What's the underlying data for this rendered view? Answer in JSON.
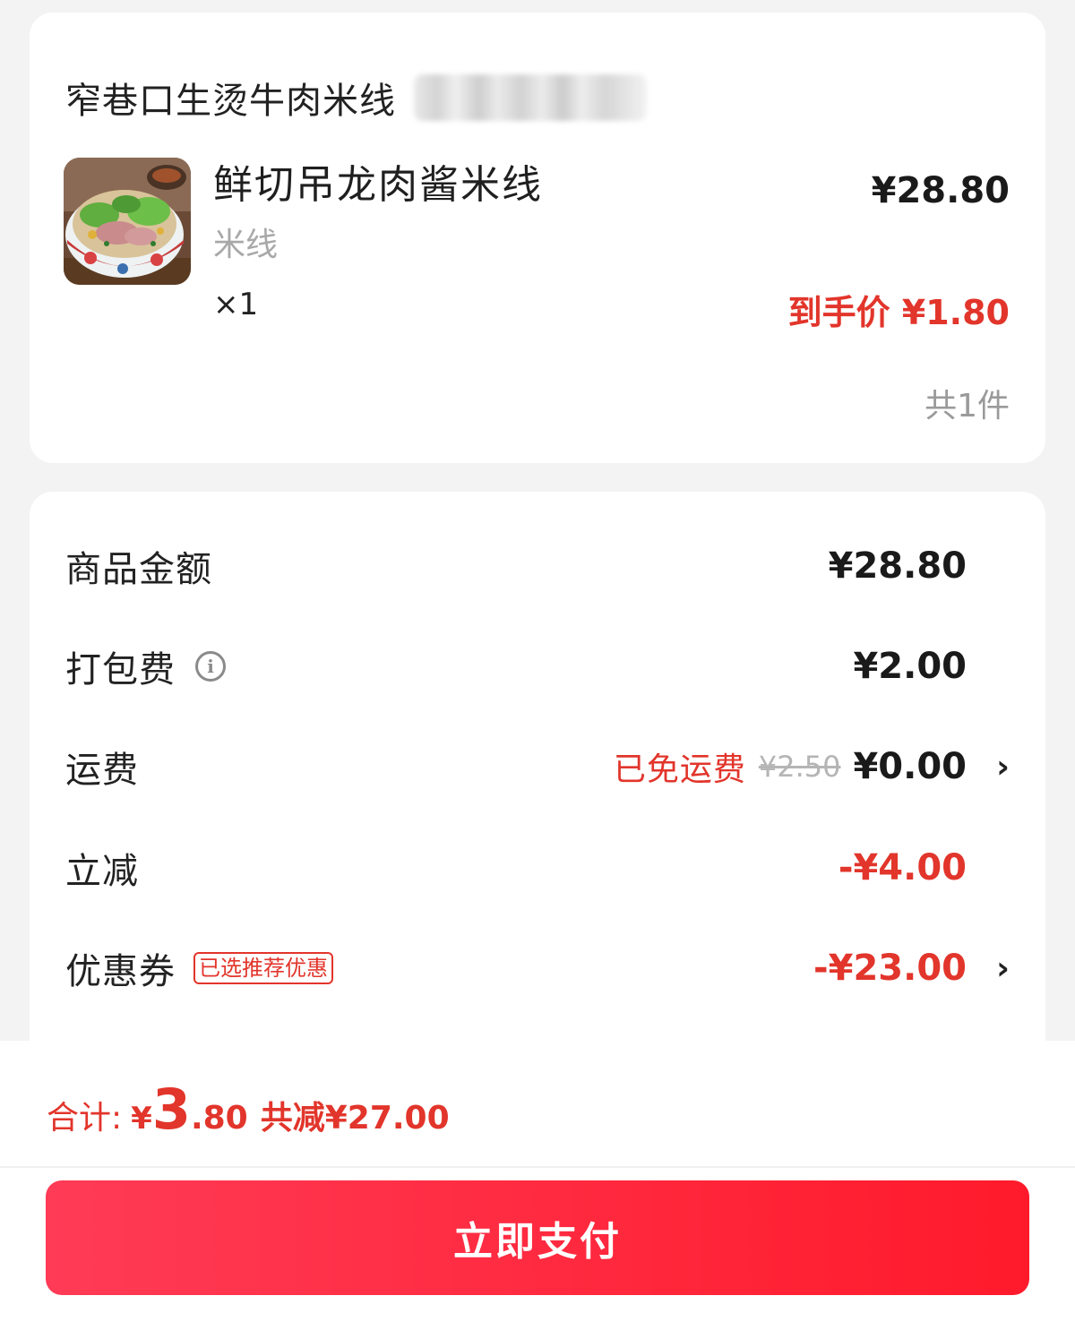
{
  "order": {
    "shop_name": "窄巷口生烫牛肉米线",
    "item": {
      "name": "鲜切吊龙肉酱米线",
      "spec": "米线",
      "qty": "×1",
      "price": "¥28.80",
      "final_price": "到手价 ¥1.80"
    },
    "item_count": "共1件"
  },
  "fees": {
    "goods_amount": {
      "label": "商品金额",
      "value": "¥28.80"
    },
    "packing_fee": {
      "label": "打包费",
      "value": "¥2.00",
      "icon": "info-icon"
    },
    "delivery_fee": {
      "label": "运费",
      "free_text": "已免运费",
      "old_value": "¥2.50",
      "value": "¥0.00"
    },
    "instant_discount": {
      "label": "立减",
      "value": "-¥4.00"
    },
    "coupon": {
      "label": "优惠券",
      "tag": "已选推荐优惠",
      "value": "-¥23.00"
    }
  },
  "footer": {
    "total_label": "合计:",
    "total_yen": "¥",
    "total_integer": "3",
    "total_decimal": ".80",
    "saved": "共减¥27.00",
    "pay_button": "立即支付"
  },
  "colors": {
    "accent_red": "#e2352b",
    "button_start": "#ff3b56",
    "button_end": "#ff1a2b"
  }
}
